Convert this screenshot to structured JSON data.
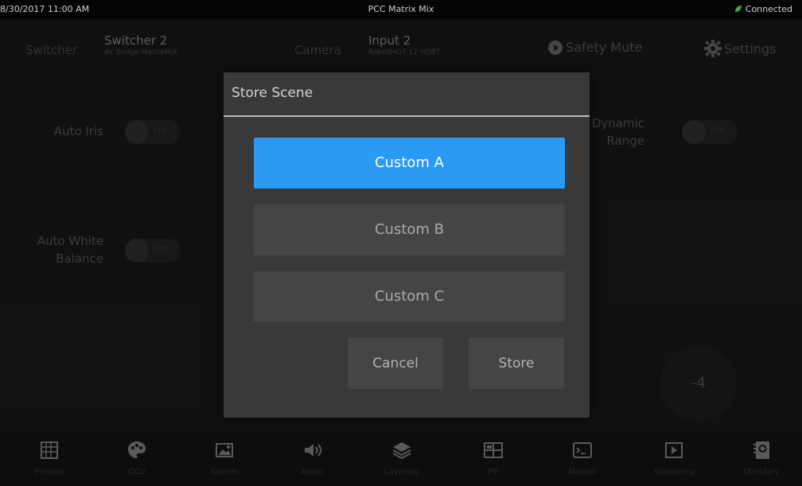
{
  "status_bar": {
    "datetime": "8/30/2017 11:00 AM",
    "title": "PCC Matrix Mix",
    "connection": "Connected",
    "connection_color": "#3fa34d"
  },
  "header": {
    "switcher_label": "Switcher",
    "switcher_name": "Switcher 2",
    "switcher_model": "AV Bridge MatrixMIX",
    "camera_label": "Camera",
    "camera_name": "Input 2",
    "camera_model": "RoboSHOT 12 HDBT",
    "safety_mute": "Safety Mute",
    "settings": "Settings"
  },
  "controls": {
    "auto_iris": "Auto Iris",
    "auto_white_balance_line1": "Auto White",
    "auto_white_balance_line2": "Balance",
    "dynamic_range_line1": "e Dynamic",
    "dynamic_range_line2": "Range",
    "toggle_state": "Off",
    "value_readout": "-4"
  },
  "nav": [
    {
      "label": "Presets",
      "icon": "grid-icon"
    },
    {
      "label": "CCU",
      "icon": "palette-icon"
    },
    {
      "label": "Scenes",
      "icon": "image-icon"
    },
    {
      "label": "Audio",
      "icon": "speaker-icon"
    },
    {
      "label": "Layering",
      "icon": "layers-icon"
    },
    {
      "label": "PIP",
      "icon": "pip-icon"
    },
    {
      "label": "Macros",
      "icon": "terminal-icon"
    },
    {
      "label": "Streaming",
      "icon": "play-icon"
    },
    {
      "label": "Directory",
      "icon": "contacts-icon"
    }
  ],
  "modal": {
    "title": "Store Scene",
    "options": [
      "Custom A",
      "Custom B",
      "Custom C"
    ],
    "selected_index": 0,
    "cancel": "Cancel",
    "store": "Store",
    "accent_color": "#2b9af3"
  }
}
